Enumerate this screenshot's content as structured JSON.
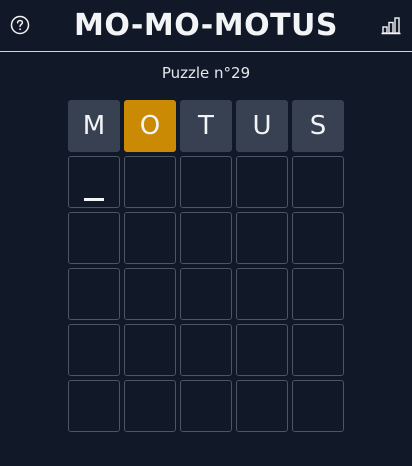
{
  "header": {
    "title": "MO-MO-MOTUS",
    "help_icon": "help-circle-icon",
    "stats_icon": "bar-chart-icon"
  },
  "puzzle": {
    "label": "Puzzle n°29"
  },
  "board": {
    "rows": [
      [
        {
          "letter": "M",
          "state": "filled"
        },
        {
          "letter": "O",
          "state": "present"
        },
        {
          "letter": "T",
          "state": "filled"
        },
        {
          "letter": "U",
          "state": "filled"
        },
        {
          "letter": "S",
          "state": "filled"
        }
      ],
      [
        {
          "letter": "",
          "state": "cursor"
        },
        {
          "letter": "",
          "state": "empty"
        },
        {
          "letter": "",
          "state": "empty"
        },
        {
          "letter": "",
          "state": "empty"
        },
        {
          "letter": "",
          "state": "empty"
        }
      ],
      [
        {
          "letter": "",
          "state": "empty"
        },
        {
          "letter": "",
          "state": "empty"
        },
        {
          "letter": "",
          "state": "empty"
        },
        {
          "letter": "",
          "state": "empty"
        },
        {
          "letter": "",
          "state": "empty"
        }
      ],
      [
        {
          "letter": "",
          "state": "empty"
        },
        {
          "letter": "",
          "state": "empty"
        },
        {
          "letter": "",
          "state": "empty"
        },
        {
          "letter": "",
          "state": "empty"
        },
        {
          "letter": "",
          "state": "empty"
        }
      ],
      [
        {
          "letter": "",
          "state": "empty"
        },
        {
          "letter": "",
          "state": "empty"
        },
        {
          "letter": "",
          "state": "empty"
        },
        {
          "letter": "",
          "state": "empty"
        },
        {
          "letter": "",
          "state": "empty"
        }
      ],
      [
        {
          "letter": "",
          "state": "empty"
        },
        {
          "letter": "",
          "state": "empty"
        },
        {
          "letter": "",
          "state": "empty"
        },
        {
          "letter": "",
          "state": "empty"
        },
        {
          "letter": "",
          "state": "empty"
        }
      ]
    ]
  },
  "colors": {
    "background": "#111827",
    "tile_filled": "#374151",
    "tile_present": "#ca8a04",
    "tile_border": "#4b5563",
    "text": "#f3f4f6"
  }
}
